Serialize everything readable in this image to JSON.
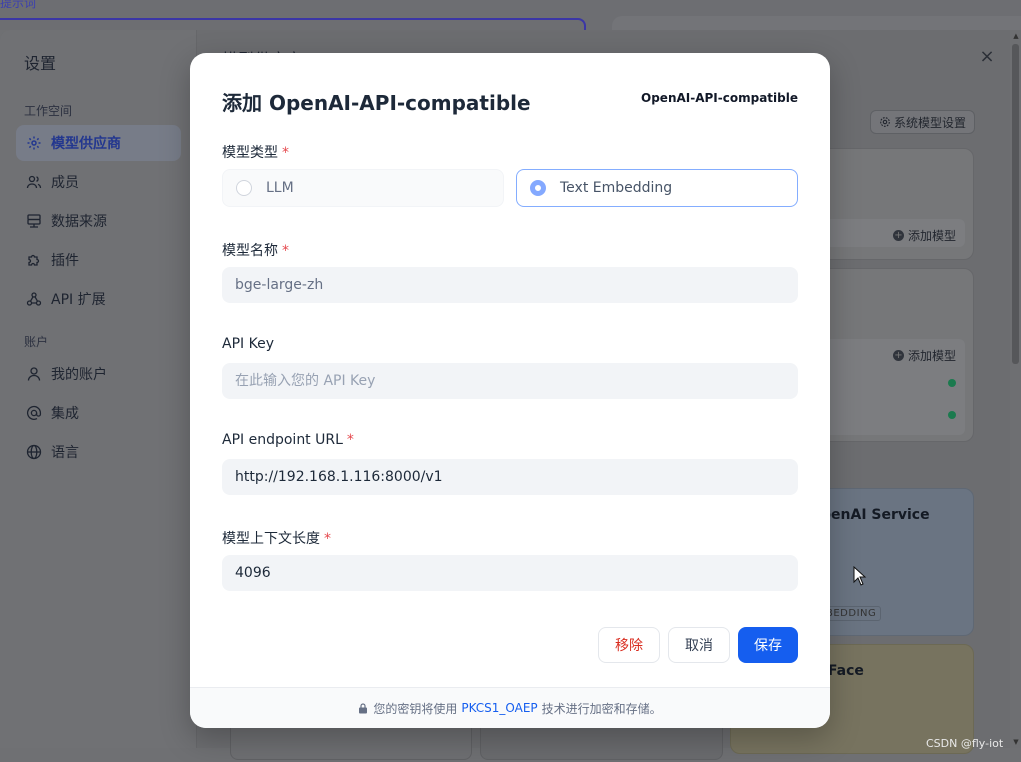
{
  "background": {
    "top_fragment": "提示词",
    "partial_heading": "模型供应商",
    "system_model_settings": "系统模型设置",
    "add_model_label": "添加模型",
    "provider_card_openai_title": "penAI Service",
    "provider_card_openai_tag": "BEDDING",
    "provider_card_hf_title": "g Face",
    "close_symbol": "×"
  },
  "sidebar": {
    "title": "设置",
    "groups": {
      "workspace": "工作空间",
      "account": "账户"
    },
    "workspace_items": [
      {
        "label": "模型供应商",
        "icon": "model-provider-icon",
        "active": true
      },
      {
        "label": "成员",
        "icon": "members-icon",
        "active": false
      },
      {
        "label": "数据来源",
        "icon": "data-source-icon",
        "active": false
      },
      {
        "label": "插件",
        "icon": "puzzle-icon",
        "active": false
      },
      {
        "label": "API 扩展",
        "icon": "api-extension-icon",
        "active": false
      }
    ],
    "account_items": [
      {
        "label": "我的账户",
        "icon": "user-icon"
      },
      {
        "label": "集成",
        "icon": "at-icon"
      },
      {
        "label": "语言",
        "icon": "globe-icon"
      }
    ]
  },
  "modal": {
    "title": "添加 OpenAI-API-compatible",
    "badge": "OpenAI-API-compatible",
    "fields": {
      "model_type": {
        "label": "模型类型",
        "required": "*",
        "options": [
          "LLM",
          "Text Embedding"
        ],
        "selected": "Text Embedding"
      },
      "model_name": {
        "label": "模型名称",
        "required": "*",
        "value": "bge-large-zh"
      },
      "api_key": {
        "label": "API Key",
        "placeholder": "在此输入您的 API Key"
      },
      "endpoint_url": {
        "label": "API endpoint URL",
        "required": "*",
        "value": "http://192.168.1.116:8000/v1"
      },
      "context_length": {
        "label": "模型上下文长度",
        "required": "*",
        "value": "4096"
      }
    },
    "buttons": {
      "remove": "移除",
      "cancel": "取消",
      "save": "保存"
    },
    "footer": {
      "prefix": "您的密钥将使用",
      "link": "PKCS1_OAEP",
      "suffix": "技术进行加密和存储。"
    }
  },
  "colors": {
    "primary": "#155eef",
    "danger": "#d92d20",
    "radio_selected_border": "#84adff"
  },
  "watermark": "CSDN @fly-iot"
}
